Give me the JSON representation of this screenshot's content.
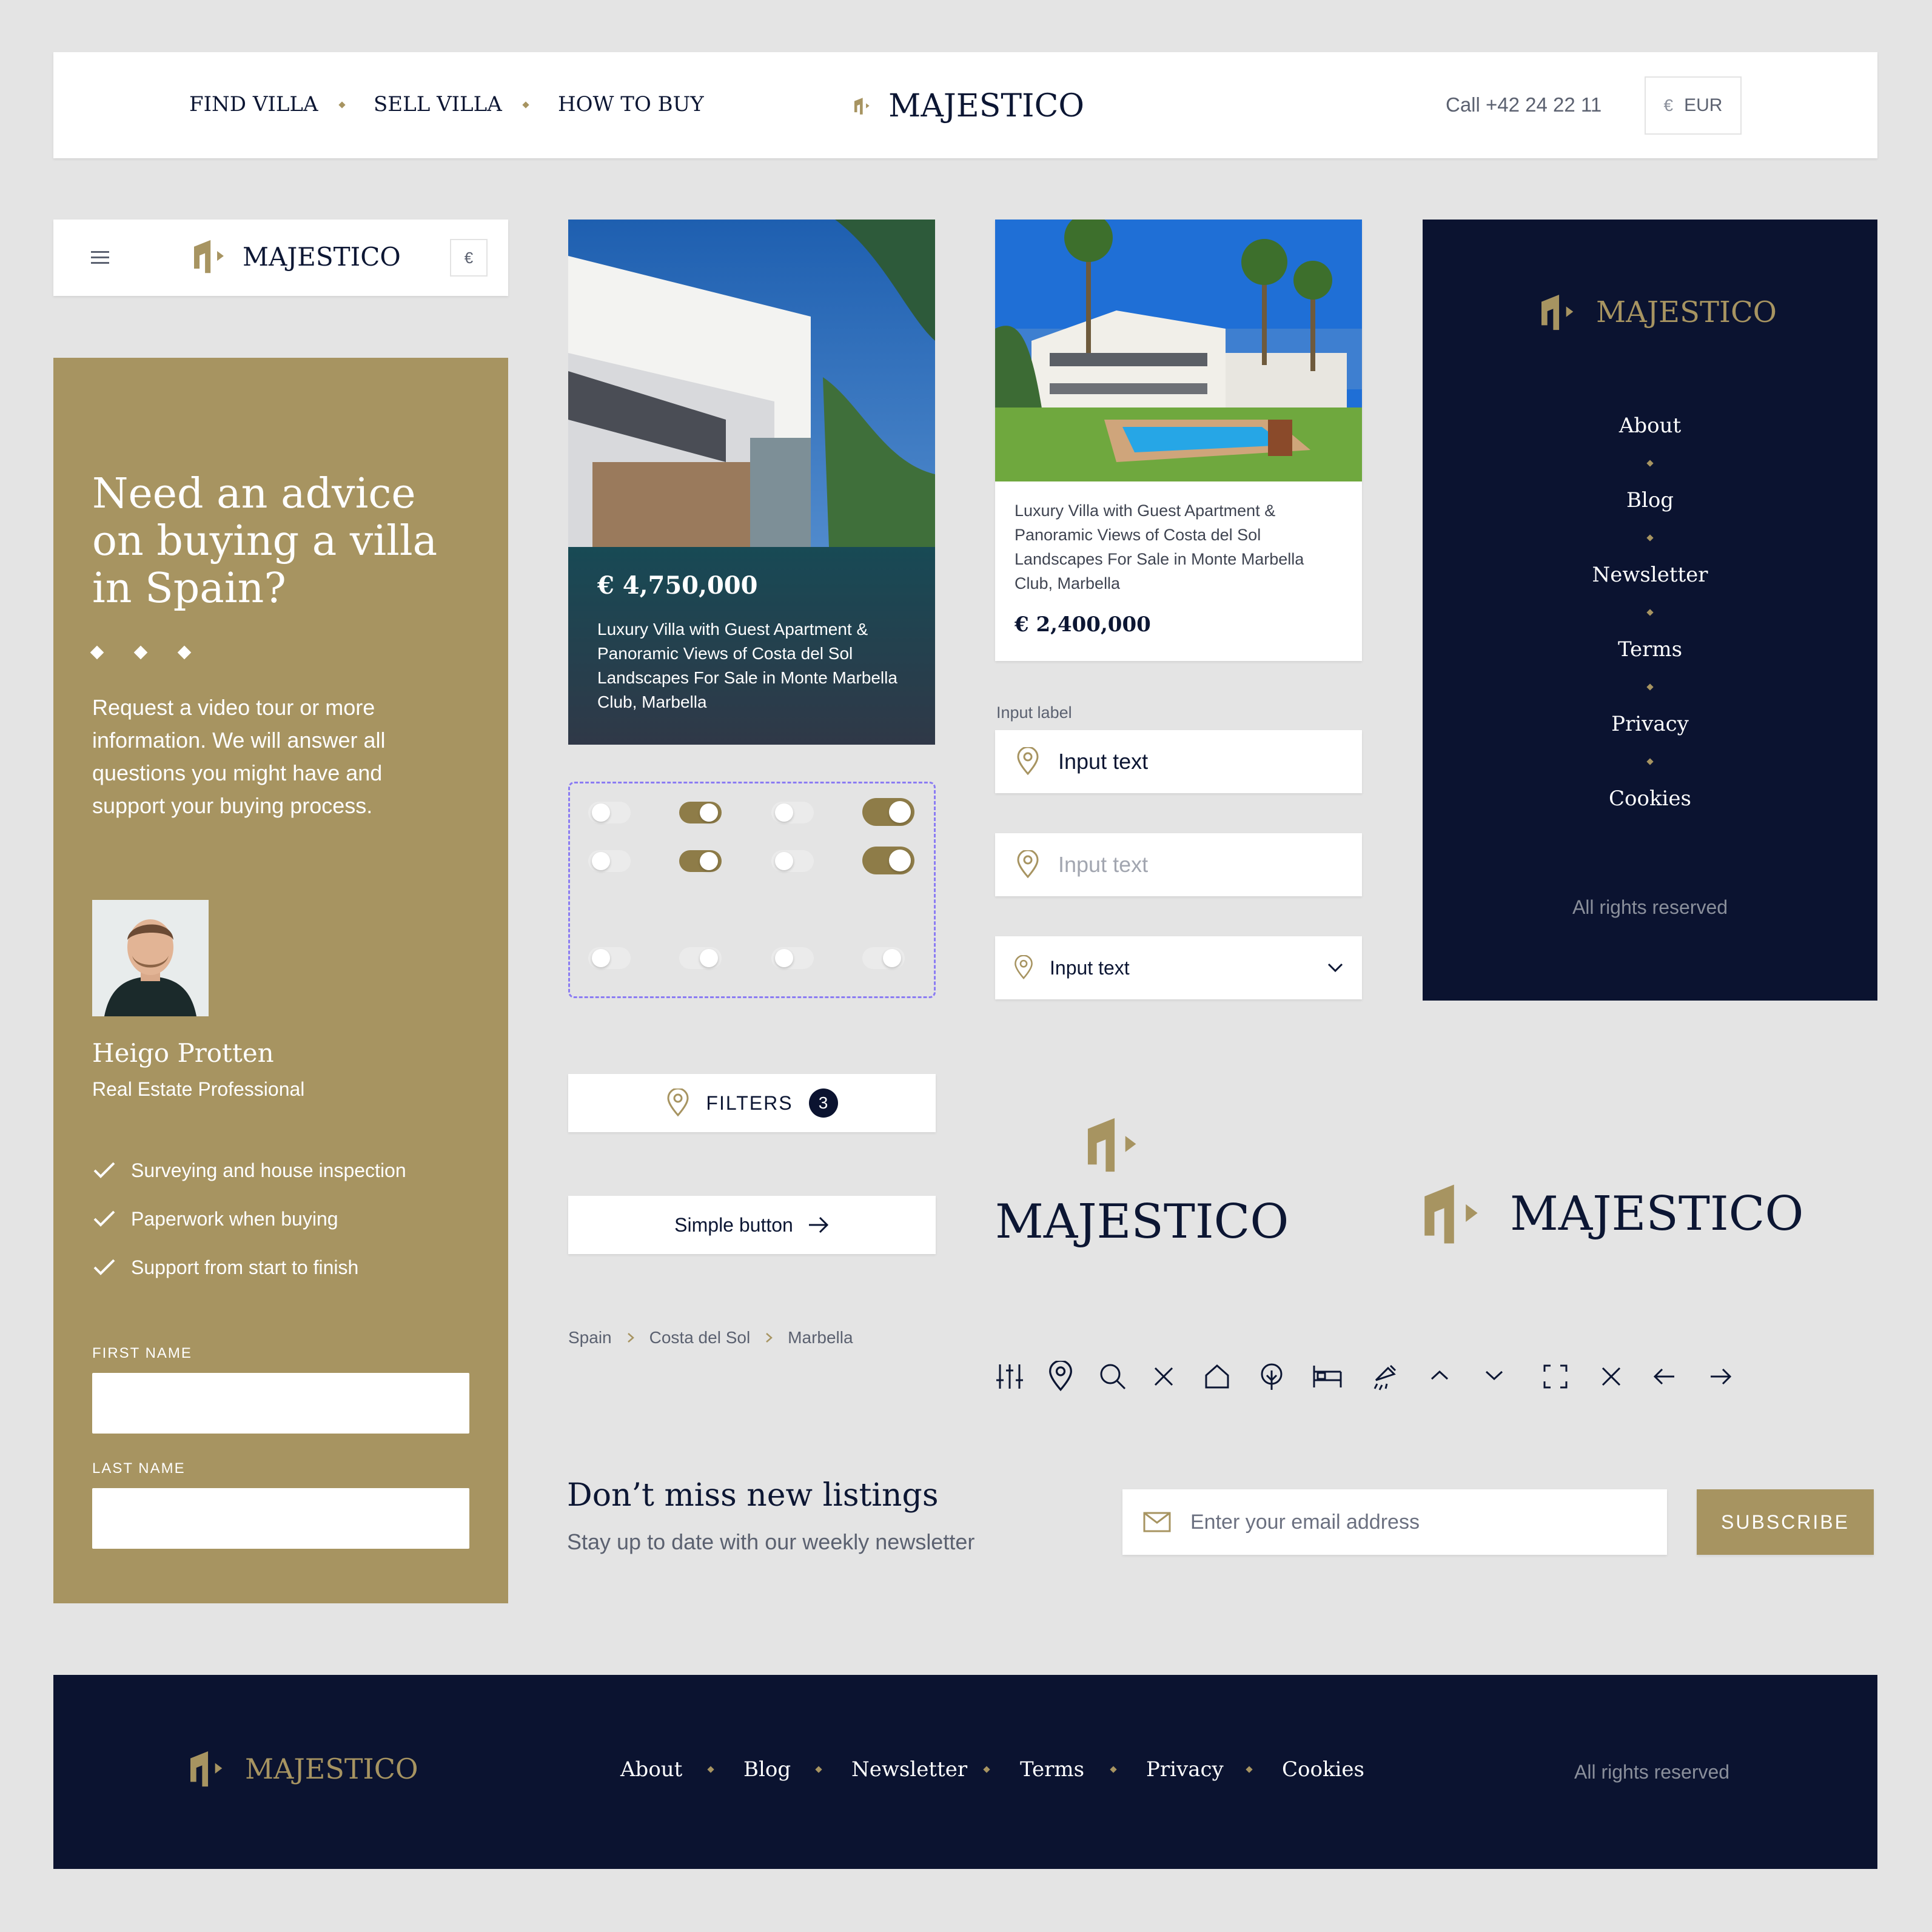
{
  "header": {
    "nav": [
      "FIND VILLA",
      "SELL VILLA",
      "HOW TO BUY"
    ],
    "logo": "MAJESTICO",
    "phone": "Call +42 24 22 11",
    "currency_symbol": "€",
    "currency": "EUR"
  },
  "mobile_header": {
    "logo": "MAJESTICO",
    "currency_symbol": "€"
  },
  "advice": {
    "title": "Need an advice on buying a villa in Spain?",
    "body": "Request a video tour or more information. We will answer all questions you might have and support your buying process.",
    "agent_name": "Heigo Protten",
    "agent_role": "Real Estate Professional",
    "checklist": [
      "Surveying and house inspection",
      "Paperwork when buying",
      "Support from start to finish"
    ],
    "first_name_label": "FIRST NAME",
    "last_name_label": "LAST NAME"
  },
  "card1": {
    "price": "€ 4,750,000",
    "title": "Luxury Villa with Guest Apartment & Panoramic Views of Costa del Sol Landscapes For Sale in Monte Marbella Club, Marbella"
  },
  "card2": {
    "title": "Luxury Villa with Guest Apartment & Panoramic Views of Costa del Sol Landscapes For Sale in Monte Marbella Club, Marbella",
    "price": "€ 2,400,000"
  },
  "inputs": {
    "label": "Input label",
    "value1": "Input text",
    "placeholder2": "Input text",
    "select_value": "Input text"
  },
  "nav_menu": {
    "logo": "MAJESTICO",
    "items": [
      "About",
      "Blog",
      "Newsletter",
      "Terms",
      "Privacy",
      "Cookies"
    ],
    "rights": "All rights reserved"
  },
  "filters": {
    "label": "FILTERS",
    "count": "3"
  },
  "simple_button": "Simple button",
  "logos": {
    "stacked": "MAJESTICO",
    "inline": "MAJESTICO"
  },
  "breadcrumb": [
    "Spain",
    "Costa del Sol",
    "Marbella"
  ],
  "icons": [
    "sliders-icon",
    "location-pin-icon",
    "search-icon",
    "close-icon",
    "home-icon",
    "tree-icon",
    "bed-icon",
    "shower-icon",
    "chevron-up-icon",
    "chevron-down-icon",
    "fullscreen-icon",
    "close-icon",
    "arrow-left-icon",
    "arrow-right-icon"
  ],
  "newsletter": {
    "title": "Don’t miss new listings",
    "subtitle": "Stay up to date with our weekly newsletter",
    "placeholder": "Enter your email address",
    "button": "SUBSCRIBE"
  },
  "footer": {
    "logo": "MAJESTICO",
    "links": [
      "About",
      "Blog",
      "Newsletter",
      "Terms",
      "Privacy",
      "Cookies"
    ],
    "rights": "All rights reserved"
  },
  "colors": {
    "gold": "#a79461",
    "navy": "#0b1330",
    "background": "#e4e4e4"
  }
}
